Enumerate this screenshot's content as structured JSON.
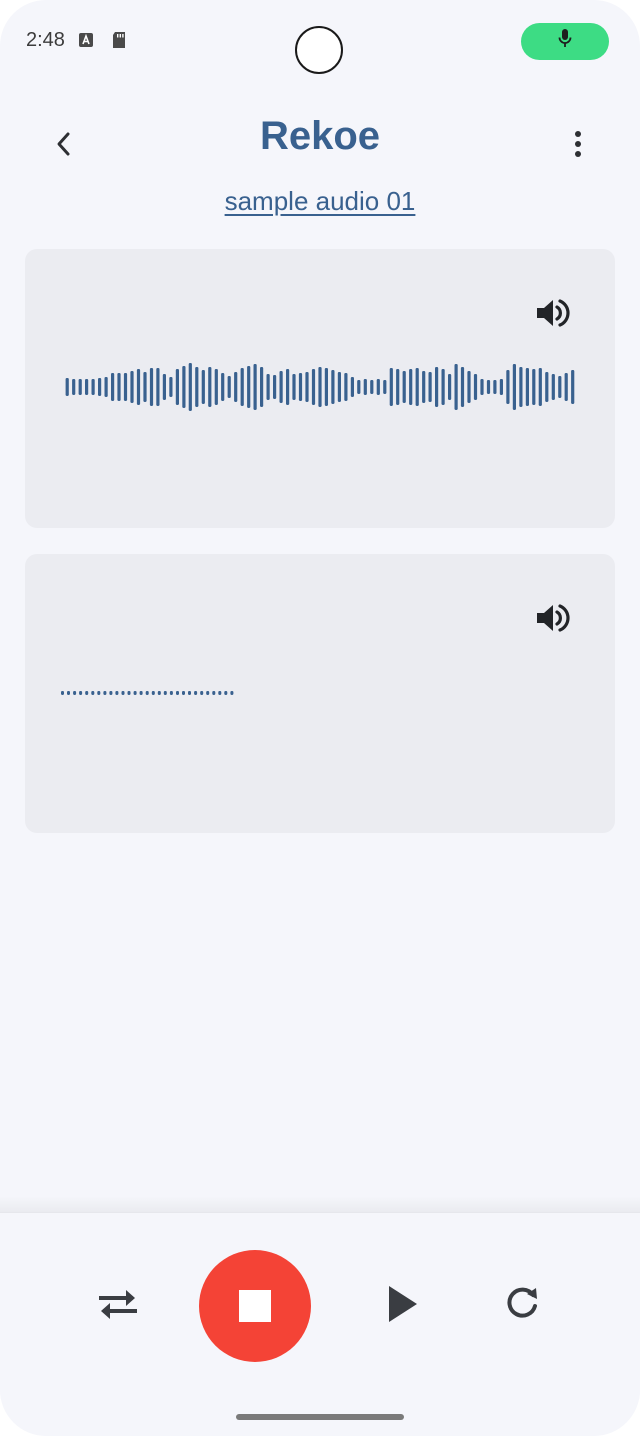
{
  "status_bar": {
    "time": "2:48",
    "icons": [
      "a-box-icon",
      "sd-card-icon",
      "camera-cutout",
      "mic-icon"
    ],
    "mic_pill_color": "#3ddc84"
  },
  "header": {
    "title": "Rekoe",
    "subtitle": "sample audio 01",
    "back_icon": "chevron-left-icon",
    "menu_icon": "more-vertical-icon"
  },
  "cards": [
    {
      "icon": "volume-icon",
      "waveform": "full-waveform"
    },
    {
      "icon": "volume-icon",
      "waveform": "dotted-waveform"
    }
  ],
  "controls": {
    "repeat_icon": "repeat-icon",
    "stop_icon": "stop-icon",
    "play_icon": "play-icon",
    "refresh_icon": "refresh-icon",
    "stop_color": "#f44336"
  },
  "colors": {
    "accent": "#39618f",
    "background": "#f5f6fb",
    "card": "#ebecf1"
  }
}
